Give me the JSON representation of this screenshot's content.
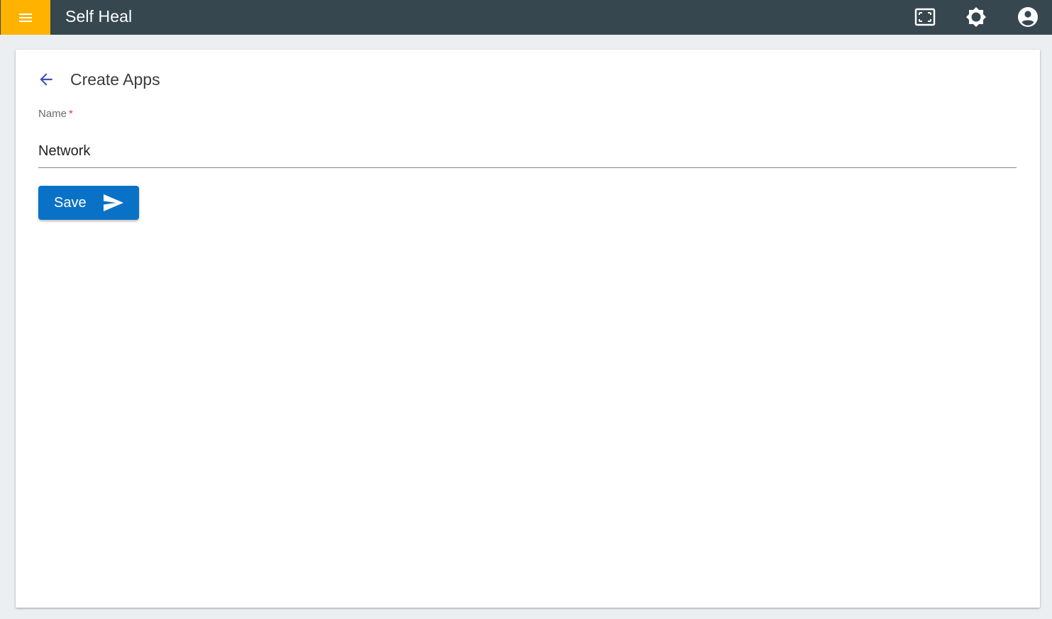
{
  "app": {
    "title": "Self Heal",
    "accent_color": "#ffb300",
    "bar_color": "#37474f"
  },
  "header": {
    "menu_icon": "menu-icon",
    "actions": [
      {
        "icon": "fullscreen-icon"
      },
      {
        "icon": "brightness-icon"
      },
      {
        "icon": "account-circle-icon"
      }
    ]
  },
  "page": {
    "title": "Create Apps",
    "back_icon": "arrow-back-icon"
  },
  "form": {
    "name_label": "Name",
    "required_marker": "*",
    "name_value": "Network",
    "save_label": "Save",
    "save_icon": "send-icon",
    "button_color": "#0a72c6"
  }
}
